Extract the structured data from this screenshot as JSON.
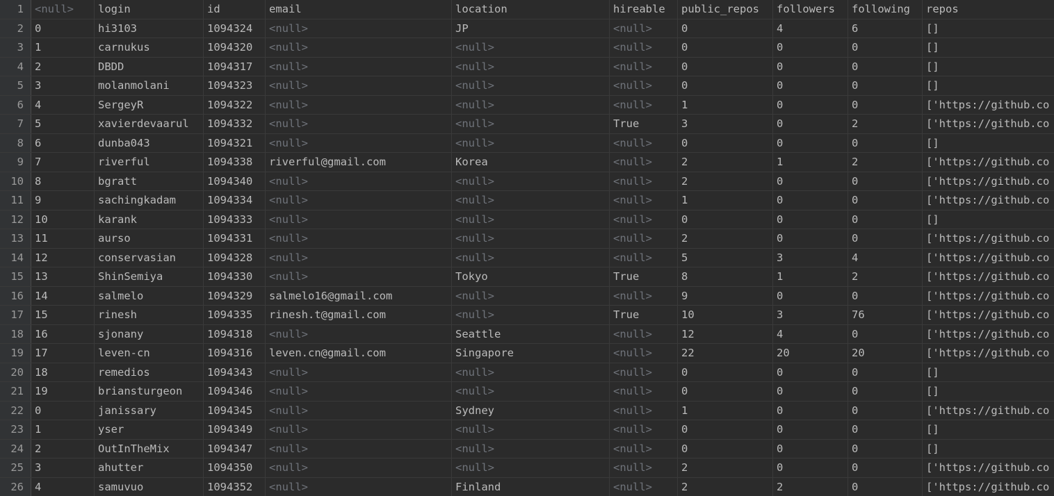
{
  "table": {
    "header": {
      "row_number": "1",
      "columns": [
        "<null>",
        "login",
        "id",
        "email",
        "location",
        "hireable",
        "public_repos",
        "followers",
        "following",
        "repos"
      ]
    },
    "rows": [
      {
        "n": "2",
        "cells": [
          "0",
          "hi3103",
          "1094324",
          "<null>",
          "JP",
          "<null>",
          "0",
          "4",
          "6",
          "[]"
        ]
      },
      {
        "n": "3",
        "cells": [
          "1",
          "carnukus",
          "1094320",
          "<null>",
          "<null>",
          "<null>",
          "0",
          "0",
          "0",
          "[]"
        ]
      },
      {
        "n": "4",
        "cells": [
          "2",
          "DBDD",
          "1094317",
          "<null>",
          "<null>",
          "<null>",
          "0",
          "0",
          "0",
          "[]"
        ]
      },
      {
        "n": "5",
        "cells": [
          "3",
          "molanmolani",
          "1094323",
          "<null>",
          "<null>",
          "<null>",
          "0",
          "0",
          "0",
          "[]"
        ]
      },
      {
        "n": "6",
        "cells": [
          "4",
          "SergeyR",
          "1094322",
          "<null>",
          "<null>",
          "<null>",
          "1",
          "0",
          "0",
          "['https://github.co"
        ]
      },
      {
        "n": "7",
        "cells": [
          "5",
          "xavierdevaarul",
          "1094332",
          "<null>",
          "<null>",
          "True",
          "3",
          "0",
          "2",
          "['https://github.co"
        ]
      },
      {
        "n": "8",
        "cells": [
          "6",
          "dunba043",
          "1094321",
          "<null>",
          "<null>",
          "<null>",
          "0",
          "0",
          "0",
          "[]"
        ]
      },
      {
        "n": "9",
        "cells": [
          "7",
          "riverful",
          "1094338",
          "riverful@gmail.com",
          "Korea",
          "<null>",
          "2",
          "1",
          "2",
          "['https://github.co"
        ]
      },
      {
        "n": "10",
        "cells": [
          "8",
          "bgratt",
          "1094340",
          "<null>",
          "<null>",
          "<null>",
          "2",
          "0",
          "0",
          "['https://github.co"
        ]
      },
      {
        "n": "11",
        "cells": [
          "9",
          "sachingkadam",
          "1094334",
          "<null>",
          "<null>",
          "<null>",
          "1",
          "0",
          "0",
          "['https://github.co"
        ]
      },
      {
        "n": "12",
        "cells": [
          "10",
          "karank",
          "1094333",
          "<null>",
          "<null>",
          "<null>",
          "0",
          "0",
          "0",
          "[]"
        ]
      },
      {
        "n": "13",
        "cells": [
          "11",
          "aurso",
          "1094331",
          "<null>",
          "<null>",
          "<null>",
          "2",
          "0",
          "0",
          "['https://github.co"
        ]
      },
      {
        "n": "14",
        "cells": [
          "12",
          "conservasian",
          "1094328",
          "<null>",
          "<null>",
          "<null>",
          "5",
          "3",
          "4",
          "['https://github.co"
        ]
      },
      {
        "n": "15",
        "cells": [
          "13",
          "ShinSemiya",
          "1094330",
          "<null>",
          "Tokyo",
          "True",
          "8",
          "1",
          "2",
          "['https://github.co"
        ]
      },
      {
        "n": "16",
        "cells": [
          "14",
          "salmelo",
          "1094329",
          "salmelo16@gmail.com",
          "<null>",
          "<null>",
          "9",
          "0",
          "0",
          "['https://github.co"
        ]
      },
      {
        "n": "17",
        "cells": [
          "15",
          "rinesh",
          "1094335",
          "rinesh.t@gmail.com",
          "<null>",
          "True",
          "10",
          "3",
          "76",
          "['https://github.co"
        ]
      },
      {
        "n": "18",
        "cells": [
          "16",
          "sjonany",
          "1094318",
          "<null>",
          "Seattle",
          "<null>",
          "12",
          "4",
          "0",
          "['https://github.co"
        ]
      },
      {
        "n": "19",
        "cells": [
          "17",
          "leven-cn",
          "1094316",
          "leven.cn@gmail.com",
          "Singapore",
          "<null>",
          "22",
          "20",
          "20",
          "['https://github.co"
        ]
      },
      {
        "n": "20",
        "cells": [
          "18",
          "remedios",
          "1094343",
          "<null>",
          "<null>",
          "<null>",
          "0",
          "0",
          "0",
          "[]"
        ]
      },
      {
        "n": "21",
        "cells": [
          "19",
          "briansturgeon",
          "1094346",
          "<null>",
          "<null>",
          "<null>",
          "0",
          "0",
          "0",
          "[]"
        ]
      },
      {
        "n": "22",
        "cells": [
          "0",
          "janissary",
          "1094345",
          "<null>",
          "Sydney",
          "<null>",
          "1",
          "0",
          "0",
          "['https://github.co"
        ]
      },
      {
        "n": "23",
        "cells": [
          "1",
          "yser",
          "1094349",
          "<null>",
          "<null>",
          "<null>",
          "0",
          "0",
          "0",
          "[]"
        ]
      },
      {
        "n": "24",
        "cells": [
          "2",
          "OutInTheMix",
          "1094347",
          "<null>",
          "<null>",
          "<null>",
          "0",
          "0",
          "0",
          "[]"
        ]
      },
      {
        "n": "25",
        "cells": [
          "3",
          "ahutter",
          "1094350",
          "<null>",
          "<null>",
          "<null>",
          "2",
          "0",
          "0",
          "['https://github.co"
        ]
      },
      {
        "n": "26",
        "cells": [
          "4",
          "samuvuo",
          "1094352",
          "<null>",
          "Finland",
          "<null>",
          "2",
          "2",
          "0",
          "['https://github.co"
        ]
      }
    ]
  }
}
